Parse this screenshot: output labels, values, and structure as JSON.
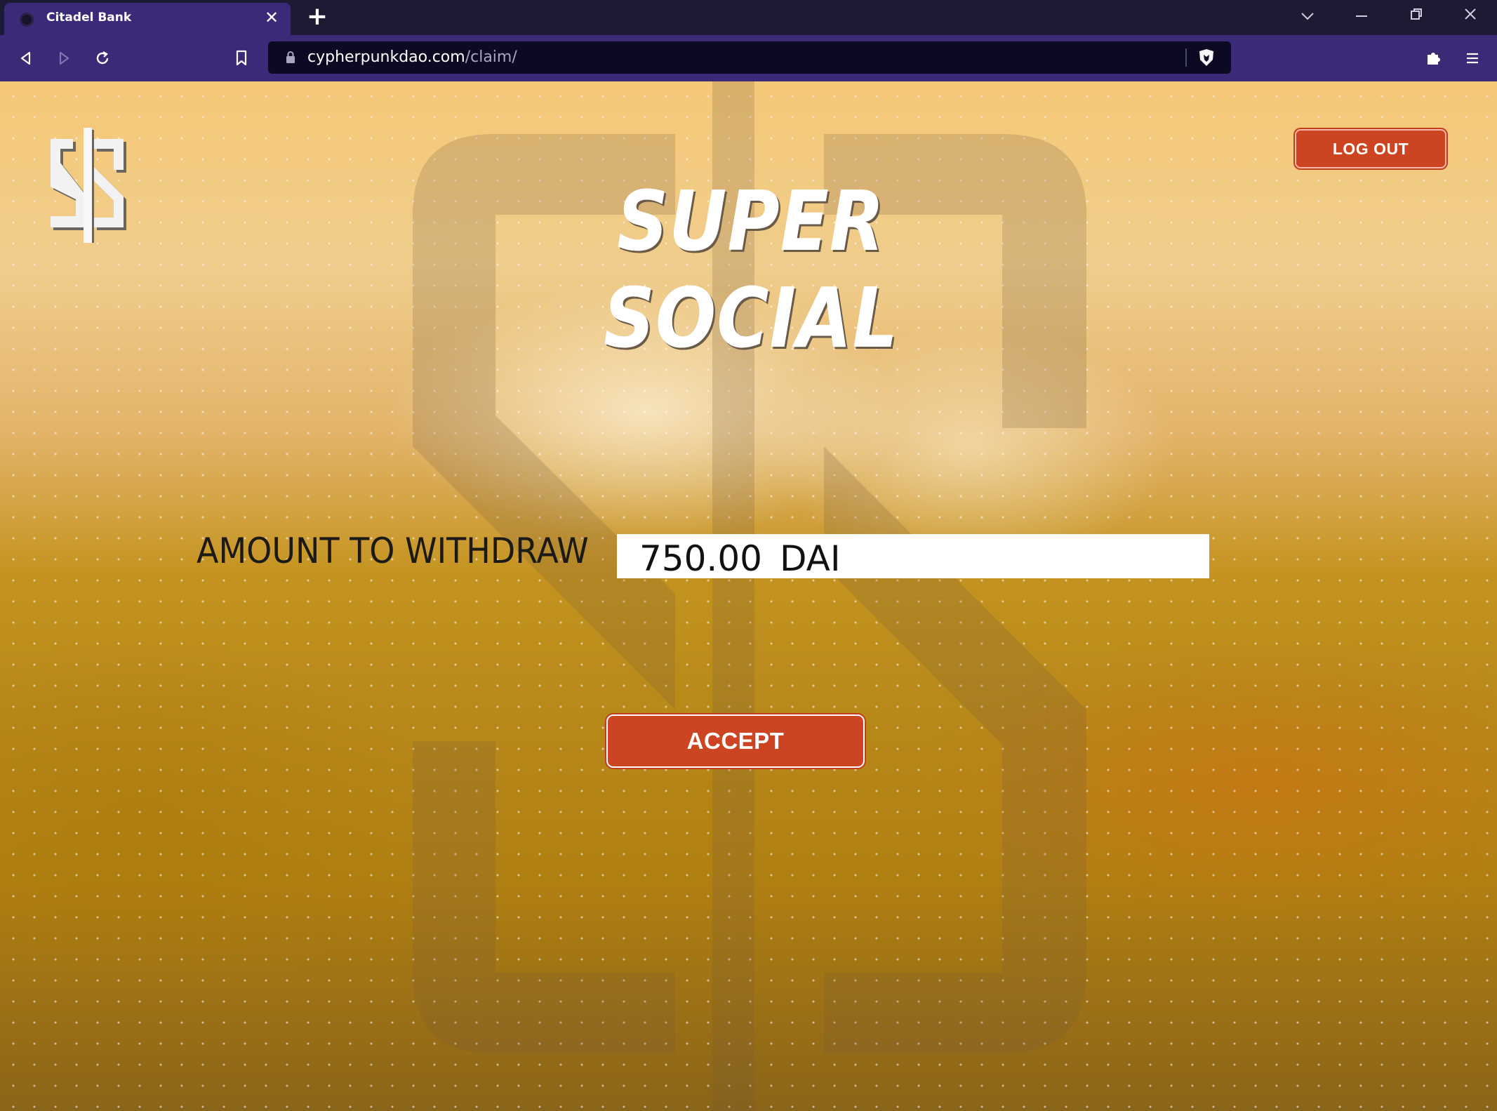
{
  "browser": {
    "tab_title": "Citadel Bank",
    "url_domain": "cypherpunkdao.com",
    "url_path": "/claim/",
    "icons": {
      "favicon": "citadel-favicon-icon",
      "tab_close": "close-icon",
      "new_tab": "plus-icon",
      "tab_list": "chevron-down-icon",
      "minimize": "minimize-icon",
      "restore": "restore-icon",
      "close_window": "close-icon",
      "back": "back-icon",
      "forward": "forward-icon",
      "reload": "reload-icon",
      "bookmark": "bookmark-icon",
      "lock": "lock-icon",
      "brave_shield": "brave-shield-icon",
      "extensions": "puzzle-icon",
      "menu": "menu-icon"
    },
    "glyphs": {
      "tab_close": "✕",
      "new_tab": "+",
      "tab_list": "⌵",
      "minimize": "—",
      "restore": "❐",
      "close_window": "✕"
    }
  },
  "page": {
    "title": "SUPER SOCIAL",
    "logout_label": "LOG OUT",
    "amount_label": "AMOUNT TO WITHDRAW",
    "amount_value": "750.00",
    "amount_unit": "DAI",
    "accept_label": "ACCEPT",
    "logo_icon": "super-social-dollar-logo-icon",
    "background_icon": "dollar-watermark-icon"
  },
  "colors": {
    "button_red": "#cc4422",
    "browser_purple": "#3a2a78",
    "url_bar": "#0c0a22",
    "background_gold": "#e3b46a"
  }
}
